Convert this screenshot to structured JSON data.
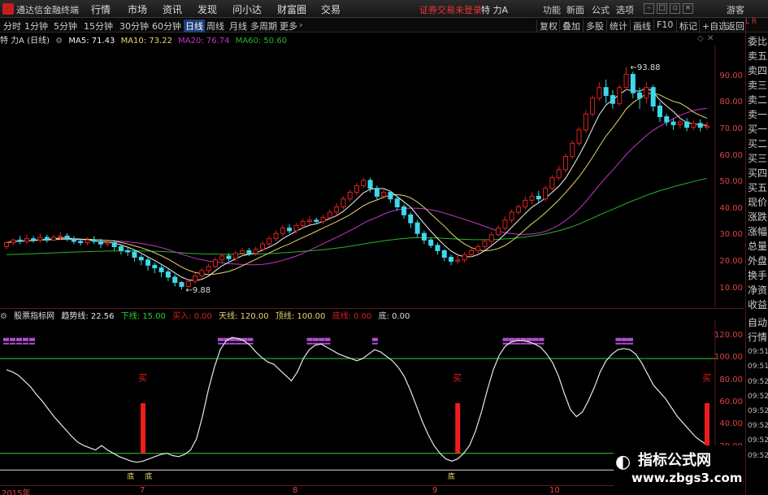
{
  "menubar": {
    "app_title": "通达信金融终端",
    "items": [
      "行情",
      "市场",
      "资讯",
      "发现",
      "问小达",
      "财富圈",
      "交易"
    ],
    "status_text": "证券交易未登录",
    "stock_name": "特 力A",
    "right_items": [
      "功能",
      "新面",
      "公式",
      "选项",
      "游客"
    ]
  },
  "toolbar": {
    "timeframes": [
      "分时",
      "1分钟",
      "5分钟",
      "15分钟",
      "30分钟",
      "60分钟",
      "日线",
      "周线",
      "月线",
      "多周期",
      "更多"
    ],
    "active": "日线",
    "buttons": [
      "复权",
      "叠加",
      "多股",
      "统计",
      "画线",
      "F10",
      "标记",
      "+自选",
      "返回"
    ]
  },
  "ma_bar": {
    "title": "特 力A (日线)",
    "ma5": "MA5: 71.43",
    "ma10": "MA10: 73.22",
    "ma20": "MA20: 76.74",
    "ma60": "MA60: 50.60"
  },
  "price_axis": [
    "90.00",
    "80.00",
    "70.00",
    "60.00",
    "50.00",
    "40.00",
    "30.00",
    "20.00",
    "10.00"
  ],
  "annotations": {
    "high": "93.88",
    "low": "9.88"
  },
  "indicator": {
    "name": "股票指标网",
    "trend": "趋势线: 22.56",
    "xia": "下线: 15.00",
    "mairu": "买入: 0.00",
    "tian": "天线: 120.00",
    "ding": "顶线: 100.00",
    "di": "底线: 0.00",
    "dilabel": "底: 0.00",
    "buy_marker": "买",
    "bottom_marker": "底",
    "axis": [
      "120.00",
      "100.00",
      "80.00",
      "60.00",
      "40.00",
      "20.00"
    ]
  },
  "sidepanel": {
    "top": "L R",
    "items": [
      "委比",
      "卖五",
      "卖四",
      "卖三",
      "卖二",
      "卖一",
      "买一",
      "买二",
      "买三",
      "买四",
      "买五",
      "现价",
      "涨跌",
      "涨幅",
      "总量",
      "外盘",
      "换手",
      "净资",
      "收益",
      "自动",
      "行情",
      "09:51",
      "09:51",
      "09:52",
      "09:52",
      "09:52",
      "09:52",
      "09:52",
      "09:52"
    ]
  },
  "dates": [
    "2015年",
    "7",
    "8",
    "9",
    "10"
  ],
  "watermark": {
    "line1": "指标公式网",
    "line2": "www.zbgs3.com",
    "icon": "◐"
  },
  "colors": {
    "up": "#e02020",
    "down": "#3fd8ea",
    "ma5": "#f2f2f2",
    "ma10": "#e6d76a",
    "ma20": "#c236c9",
    "ma60": "#28b428",
    "trend": "#e8e8e8",
    "green_line": "#2fcf2f"
  },
  "chart_data": [
    {
      "type": "candlestick",
      "ylim": [
        5,
        100
      ],
      "ylabels": [
        "90.00",
        "80.00",
        "70.00",
        "60.00",
        "50.00",
        "40.00",
        "30.00",
        "20.00",
        "10.00"
      ],
      "candles": [
        [
          26,
          27.5,
          25,
          28
        ],
        [
          27.5,
          28.5,
          26.5,
          29
        ],
        [
          28.5,
          28,
          27,
          30
        ],
        [
          28,
          29,
          27,
          30.5
        ],
        [
          29,
          28.5,
          27.5,
          30
        ],
        [
          28.5,
          29.5,
          27.5,
          31
        ],
        [
          29.5,
          28.5,
          27.5,
          30.5
        ],
        [
          28.5,
          29.5,
          28,
          30.5
        ],
        [
          29.5,
          30,
          28.5,
          31.5
        ],
        [
          30,
          29,
          28,
          31
        ],
        [
          29,
          28,
          27,
          30
        ],
        [
          28,
          27.5,
          26.5,
          29
        ],
        [
          27.5,
          28.5,
          26.5,
          29.5
        ],
        [
          28.5,
          28,
          27,
          30
        ],
        [
          28,
          27,
          25.5,
          29
        ],
        [
          27,
          27.5,
          26,
          28.5
        ],
        [
          27.5,
          26,
          24.5,
          28.5
        ],
        [
          26,
          24.5,
          23,
          27
        ],
        [
          24.5,
          24,
          22.5,
          25.5
        ],
        [
          24,
          22,
          20.5,
          25
        ],
        [
          22,
          21,
          19,
          23
        ],
        [
          21,
          19,
          17,
          22
        ],
        [
          19,
          18,
          16,
          20
        ],
        [
          18,
          16.5,
          14.5,
          19
        ],
        [
          16.5,
          14.5,
          13,
          17.5
        ],
        [
          14.5,
          12.5,
          11,
          15.5
        ],
        [
          12.5,
          11,
          9.88,
          13
        ],
        [
          11,
          13,
          10.5,
          14
        ],
        [
          13,
          15,
          12,
          16
        ],
        [
          15,
          17,
          14,
          18
        ],
        [
          17,
          18.5,
          16,
          19.5
        ],
        [
          18.5,
          21,
          18,
          22
        ],
        [
          21,
          22.5,
          20,
          23.5
        ],
        [
          22.5,
          21.5,
          20.5,
          23.5
        ],
        [
          21.5,
          23.5,
          20.5,
          24.5
        ],
        [
          23.5,
          24.5,
          22.5,
          25.5
        ],
        [
          24.5,
          23.5,
          22.5,
          25.5
        ],
        [
          23.5,
          25,
          22.5,
          26
        ],
        [
          25,
          27,
          24,
          28
        ],
        [
          27,
          29,
          26,
          30
        ],
        [
          29,
          31,
          28,
          32
        ],
        [
          31,
          33,
          30,
          34
        ],
        [
          33,
          32,
          31,
          34.5
        ],
        [
          32,
          34,
          31,
          35
        ],
        [
          34,
          35.5,
          33,
          36.5
        ],
        [
          35.5,
          36,
          34.5,
          37.5
        ],
        [
          36,
          35.5,
          34.5,
          37
        ],
        [
          35.5,
          37,
          34.5,
          38
        ],
        [
          37,
          39,
          36,
          40
        ],
        [
          39,
          41,
          38,
          42.5
        ],
        [
          41,
          44,
          40,
          45
        ],
        [
          44,
          46.5,
          43,
          47.5
        ],
        [
          46.5,
          49,
          45.5,
          50
        ],
        [
          49,
          51,
          48,
          52
        ],
        [
          51,
          48,
          46.5,
          52
        ],
        [
          48,
          45,
          43.5,
          49
        ],
        [
          45,
          46.5,
          44,
          47.5
        ],
        [
          46.5,
          44,
          42.5,
          47
        ],
        [
          44,
          41,
          39.5,
          45
        ],
        [
          41,
          38,
          36.5,
          42
        ],
        [
          38,
          35,
          33,
          39
        ],
        [
          35,
          31,
          29.5,
          36
        ],
        [
          31,
          28.5,
          27,
          32
        ],
        [
          28.5,
          26.5,
          25.5,
          29.5
        ],
        [
          26.5,
          24.5,
          23,
          27.5
        ],
        [
          24.5,
          22,
          20.5,
          25
        ],
        [
          22,
          20.5,
          19,
          23
        ],
        [
          20.5,
          21,
          19.5,
          22.5
        ],
        [
          21,
          23,
          20,
          24
        ],
        [
          23,
          24.5,
          22,
          25.5
        ],
        [
          24.5,
          26,
          23.5,
          27
        ],
        [
          26,
          28,
          25,
          29
        ],
        [
          28,
          30.5,
          27,
          31.5
        ],
        [
          30.5,
          33,
          30,
          34
        ],
        [
          33,
          36,
          32,
          37.5
        ],
        [
          36,
          39,
          35,
          40
        ],
        [
          39,
          41,
          38,
          42
        ],
        [
          41,
          43.5,
          40,
          45
        ],
        [
          43.5,
          45,
          42,
          46.5
        ],
        [
          45,
          44,
          42.5,
          47
        ],
        [
          44,
          48,
          43,
          49
        ],
        [
          48,
          52,
          47,
          53
        ],
        [
          52,
          55,
          51,
          56.5
        ],
        [
          55,
          60,
          54,
          61
        ],
        [
          60,
          65,
          59,
          66
        ],
        [
          65,
          70,
          64,
          71
        ],
        [
          70,
          76,
          69,
          77.5
        ],
        [
          76,
          82,
          75,
          83
        ],
        [
          82,
          86,
          81,
          88
        ],
        [
          86,
          83,
          80,
          89
        ],
        [
          83,
          80,
          78,
          85
        ],
        [
          80,
          86,
          79,
          87
        ],
        [
          86,
          91,
          85,
          93.88
        ],
        [
          91,
          84,
          82,
          92
        ],
        [
          84,
          82,
          78,
          86
        ],
        [
          82,
          86,
          80,
          88
        ],
        [
          86,
          79,
          77,
          87
        ],
        [
          79,
          75,
          73,
          80.5
        ],
        [
          75,
          73,
          71.5,
          76
        ],
        [
          73,
          72,
          70,
          74.5
        ],
        [
          72,
          73,
          70.5,
          74
        ],
        [
          73,
          71,
          69.5,
          74.5
        ],
        [
          71,
          72.5,
          70,
          73.5
        ],
        [
          72.5,
          71,
          69.5,
          74
        ],
        [
          71,
          71.43,
          70,
          73
        ]
      ]
    },
    {
      "type": "line",
      "ylim": [
        -10,
        130
      ],
      "trend": [
        90,
        88,
        85,
        80,
        75,
        68,
        62,
        55,
        48,
        42,
        36,
        30,
        25,
        22,
        20,
        18,
        22,
        18,
        15,
        12,
        10,
        8,
        7,
        8,
        10,
        12,
        14,
        15,
        13,
        12,
        14,
        18,
        28,
        48,
        72,
        92,
        108,
        116,
        119,
        118,
        116,
        112,
        106,
        101,
        97,
        95,
        90,
        85,
        80,
        88,
        100,
        108,
        112,
        113,
        110,
        107,
        104,
        102,
        100,
        98,
        100,
        104,
        108,
        106,
        102,
        98,
        92,
        84,
        72,
        58,
        44,
        32,
        22,
        15,
        10,
        8,
        10,
        15,
        22,
        35,
        52,
        72,
        90,
        103,
        111,
        115,
        116,
        116,
        115,
        113,
        110,
        104,
        96,
        84,
        68,
        54,
        48,
        52,
        62,
        74,
        88,
        98,
        104,
        108,
        109,
        108,
        104,
        96,
        86,
        76,
        70,
        64,
        56,
        48,
        42,
        36,
        30,
        26,
        22.56
      ]
    }
  ]
}
